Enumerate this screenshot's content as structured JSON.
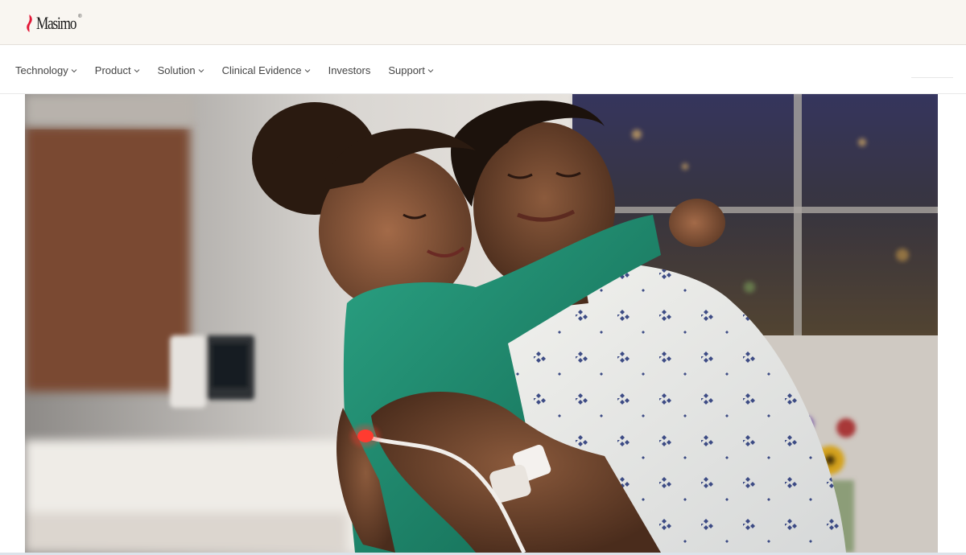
{
  "brand": {
    "name": "Masimo",
    "registered": "®",
    "accent": "#e31837"
  },
  "nav": {
    "items": [
      {
        "label": "Technology",
        "has_dropdown": true
      },
      {
        "label": "Product",
        "has_dropdown": true
      },
      {
        "label": "Solution",
        "has_dropdown": true
      },
      {
        "label": "Clinical Evidence",
        "has_dropdown": true
      },
      {
        "label": "Investors",
        "has_dropdown": false
      },
      {
        "label": "Support",
        "has_dropdown": true
      }
    ]
  },
  "hero": {
    "image": "hero-photo",
    "icon": "hero-image"
  },
  "colors": {
    "topbar_bg": "#f9f6f1",
    "nav_text": "#444444",
    "gown_pattern": "#2a3a7a",
    "shirt_green": "#1f8a70",
    "sensor_red": "#ff3b30"
  }
}
